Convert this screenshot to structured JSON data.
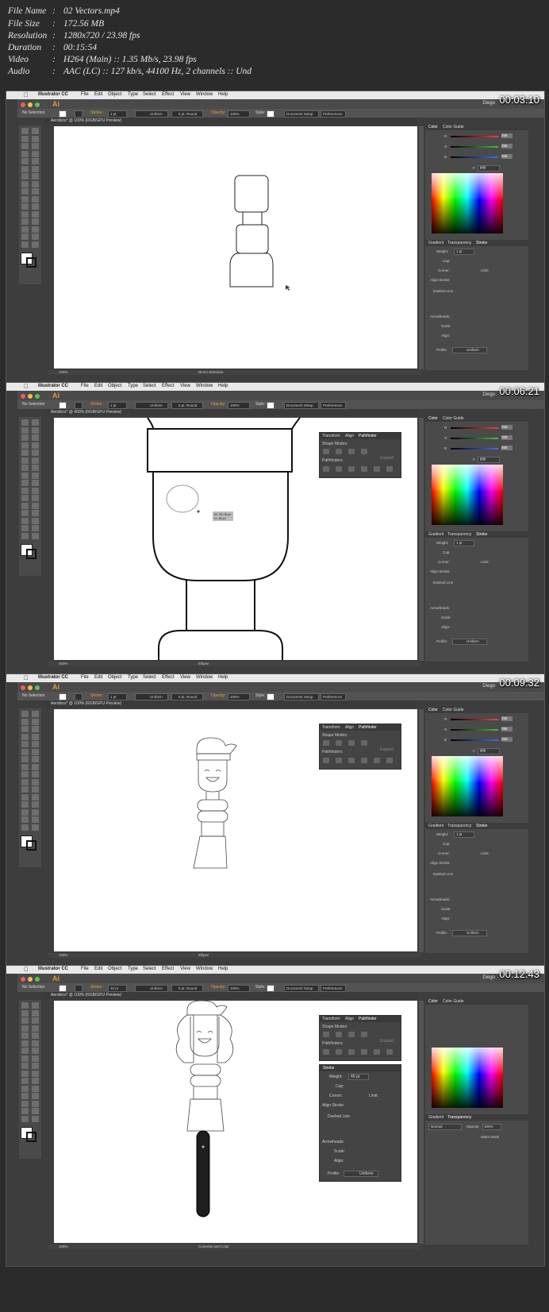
{
  "meta": {
    "rows": [
      {
        "key": "File Name",
        "sep": ":",
        "value": "02 Vectors.mp4"
      },
      {
        "key": "File Size",
        "sep": ":",
        "value": "172.56 MB"
      },
      {
        "key": "Resolution",
        "sep": ":",
        "value": "1280x720 / 23.98 fps"
      },
      {
        "key": "Duration",
        "sep": ":",
        "value": "00:15:54"
      },
      {
        "key": "Video",
        "sep": ":",
        "value": "H264 (Main) :: 1.35 Mb/s, 23.98 fps"
      },
      {
        "key": "Audio",
        "sep": ":",
        "value": "AAC (LC) :: 127 kb/s, 44100 Hz, 2 channels :: Und"
      }
    ]
  },
  "common": {
    "app_name": "Illustrator CC",
    "app_logo": "Ai",
    "menus": [
      "File",
      "Edit",
      "Object",
      "Type",
      "Select",
      "Effect",
      "View",
      "Window",
      "Help"
    ],
    "user": "Diego",
    "selection_label": "No Selection",
    "stroke_label": "Stroke:",
    "stroke_value": "1 pt",
    "uniform_label": "Uniform",
    "round_label": "5 pt. Round",
    "opacity_label": "Opacity:",
    "opacity_value": "100%",
    "style_label": "Style:",
    "doc_setup_label": "Document Setup",
    "preferences_label": "Preferences",
    "color_tab": "Color",
    "color_guide_tab": "Color Guide",
    "gradient_tab": "Gradient",
    "transparency_tab": "Transparency",
    "stroke_tab": "Stroke",
    "weight_label": "Weight:",
    "cap_label": "Cap:",
    "corner_label": "Corner:",
    "limit_label": "Limit:",
    "align_stroke_label": "Align Stroke:",
    "dashed_line_label": "Dashed Line",
    "arrowheads_label": "Arrowheads:",
    "scale_label": "Scale:",
    "align_label": "Align:",
    "profile_label": "Profile:",
    "profile_value": "Uniform",
    "r_label": "R",
    "g_label": "G",
    "b_label": "B",
    "rgb_value": "255",
    "hex_label": "#",
    "hex_value": "ffffff",
    "transform_tab": "Transform",
    "align_tab": "Align",
    "pathfinder_tab": "Pathfinder",
    "shape_modes_label": "Shape Modes:",
    "pathfinders_label": "Pathfinders:",
    "expand_label": "Expand",
    "blend_mode": "Normal",
    "transparency_opacity_label": "Opacity:",
    "transparency_opacity_value": "100%",
    "make_mask_label": "Make Mask"
  },
  "frames": [
    {
      "timestamp": "00:03:10",
      "doc_tab": "Aerobics* @ 100% (RGB/GPU Preview)",
      "zoom": "100%",
      "status": "Direct Selection",
      "weight_value": "1 pt"
    },
    {
      "timestamp": "00:06:21",
      "doc_tab": "Aerobics* @ 400% (RGB/GPU Preview)",
      "zoom": "400%",
      "status": "Ellipse",
      "weight_value": "1 pt",
      "measure_w": "W: 33.26 px",
      "measure_h": "H: 38 px"
    },
    {
      "timestamp": "00:09:32",
      "doc_tab": "Aerobics* @ 100% (RGB/GPU Preview)",
      "zoom": "100%",
      "status": "Ellipse",
      "weight_value": "1 pt"
    },
    {
      "timestamp": "00:12:43",
      "doc_tab": "Aerobics* @ 100% (RGB/GPU Preview)",
      "zoom": "100%",
      "status": "Contents and Color",
      "weight_value": "40 pt",
      "stroke_value": "40 pt"
    }
  ]
}
